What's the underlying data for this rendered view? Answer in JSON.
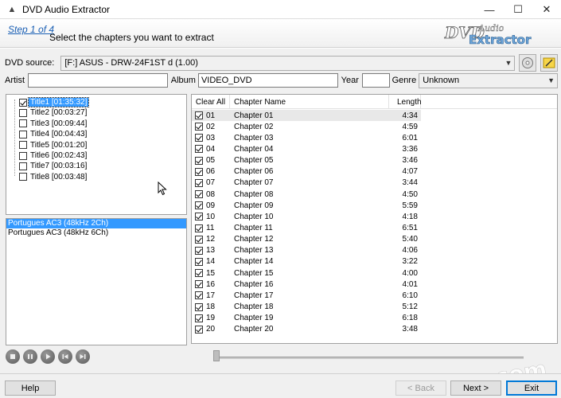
{
  "window": {
    "title": "DVD Audio Extractor",
    "controls": [
      "minimize",
      "maximize",
      "close"
    ]
  },
  "header": {
    "step": "Step 1 of 4",
    "description": "Select the chapters you want to extract",
    "logo_text_top": "DVD Audio",
    "logo_text_bottom": "Extractor"
  },
  "source": {
    "label": "DVD source:",
    "value": "[F:]  ASUS    - DRW-24F1ST   d   (1.00)"
  },
  "meta": {
    "artist_label": "Artist",
    "artist_value": "",
    "album_label": "Album",
    "album_value": "VIDEO_DVD",
    "year_label": "Year",
    "year_value": "",
    "genre_label": "Genre",
    "genre_value": "Unknown"
  },
  "titles": [
    {
      "label": "Title1 [01:35:32]",
      "checked": true,
      "selected": true
    },
    {
      "label": "Title2 [00:03:27]",
      "checked": false,
      "selected": false
    },
    {
      "label": "Title3 [00:09:44]",
      "checked": false,
      "selected": false
    },
    {
      "label": "Title4 [00:04:43]",
      "checked": false,
      "selected": false
    },
    {
      "label": "Title5 [00:01:20]",
      "checked": false,
      "selected": false
    },
    {
      "label": "Title6 [00:02:43]",
      "checked": false,
      "selected": false
    },
    {
      "label": "Title7 [00:03:16]",
      "checked": false,
      "selected": false
    },
    {
      "label": "Title8 [00:03:48]",
      "checked": false,
      "selected": false
    }
  ],
  "audio_tracks": [
    {
      "label": "Portugues AC3 (48kHz 2Ch)",
      "selected": true
    },
    {
      "label": "Portugues AC3 (48kHz 6Ch)",
      "selected": false
    }
  ],
  "chapters": {
    "header_clear": "Clear All",
    "header_name": "Chapter Name",
    "header_length": "Length",
    "rows": [
      {
        "num": "01",
        "name": "Chapter 01",
        "length": "4:34"
      },
      {
        "num": "02",
        "name": "Chapter 02",
        "length": "4:59"
      },
      {
        "num": "03",
        "name": "Chapter 03",
        "length": "6:01"
      },
      {
        "num": "04",
        "name": "Chapter 04",
        "length": "3:36"
      },
      {
        "num": "05",
        "name": "Chapter 05",
        "length": "3:46"
      },
      {
        "num": "06",
        "name": "Chapter 06",
        "length": "4:07"
      },
      {
        "num": "07",
        "name": "Chapter 07",
        "length": "3:44"
      },
      {
        "num": "08",
        "name": "Chapter 08",
        "length": "4:50"
      },
      {
        "num": "09",
        "name": "Chapter 09",
        "length": "5:59"
      },
      {
        "num": "10",
        "name": "Chapter 10",
        "length": "4:18"
      },
      {
        "num": "11",
        "name": "Chapter 11",
        "length": "6:51"
      },
      {
        "num": "12",
        "name": "Chapter 12",
        "length": "5:40"
      },
      {
        "num": "13",
        "name": "Chapter 13",
        "length": "4:06"
      },
      {
        "num": "14",
        "name": "Chapter 14",
        "length": "3:22"
      },
      {
        "num": "15",
        "name": "Chapter 15",
        "length": "4:00"
      },
      {
        "num": "16",
        "name": "Chapter 16",
        "length": "4:01"
      },
      {
        "num": "17",
        "name": "Chapter 17",
        "length": "6:10"
      },
      {
        "num": "18",
        "name": "Chapter 18",
        "length": "5:12"
      },
      {
        "num": "19",
        "name": "Chapter 19",
        "length": "6:18"
      },
      {
        "num": "20",
        "name": "Chapter 20",
        "length": "3:48"
      }
    ]
  },
  "player_buttons": [
    "stop-icon",
    "pause-icon",
    "play-icon",
    "previous-icon",
    "next-track-icon"
  ],
  "footer": {
    "help": "Help",
    "back": "< Back",
    "next": "Next >",
    "exit": "Exit"
  },
  "watermark": {
    "text": "FileOur.com"
  }
}
